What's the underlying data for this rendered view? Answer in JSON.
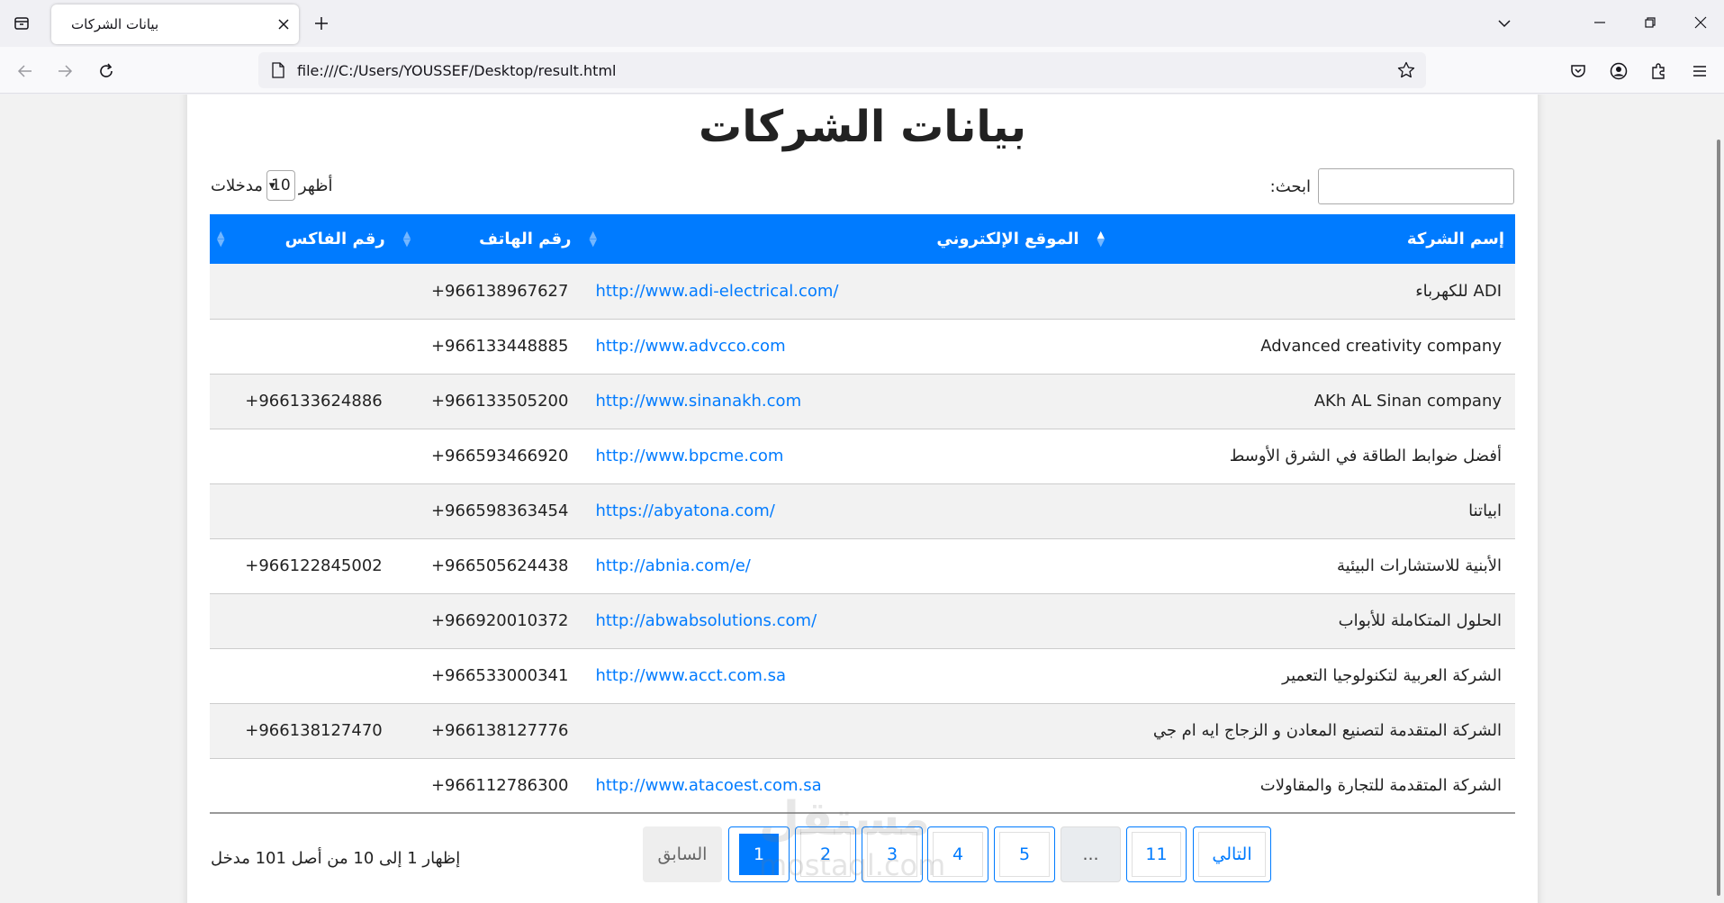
{
  "browser": {
    "tab_title": "بيانات الشركات",
    "url": "file:///C:/Users/YOUSSEF/Desktop/result.html"
  },
  "page": {
    "title": "بيانات الشركات",
    "length": {
      "show": "أظهر",
      "value": "10",
      "entries": "مدخلات"
    },
    "search_label": ":ابحث",
    "search_value": "",
    "columns": [
      "إسم الشركة",
      "الموقع الإلكتروني",
      "رقم الهاتف",
      "رقم الفاكس"
    ],
    "rows": [
      {
        "name": "ADI للكهرباء",
        "website": "http://www.adi-electrical.com/",
        "phone": "+966138967627",
        "fax": ""
      },
      {
        "name": "Advanced creativity company",
        "website": "http://www.advcco.com",
        "phone": "+966133448885",
        "fax": ""
      },
      {
        "name": "AKh AL Sinan company",
        "website": "http://www.sinanakh.com",
        "phone": "+966133505200",
        "fax": "+966133624886"
      },
      {
        "name": "أفضل ضوابط الطاقة في الشرق الأوسط",
        "website": "http://www.bpcme.com",
        "phone": "+966593466920",
        "fax": ""
      },
      {
        "name": "ابياتنا",
        "website": "https://abyatona.com/",
        "phone": "+966598363454",
        "fax": ""
      },
      {
        "name": "الأبنية للاستشارات البيئية",
        "website": "http://abnia.com/e/",
        "phone": "+966505624438",
        "fax": "+966122845002"
      },
      {
        "name": "الحلول المتكاملة للأبواب",
        "website": "http://abwabsolutions.com/",
        "phone": "+966920010372",
        "fax": ""
      },
      {
        "name": "الشركة العربية لتكنولوجيا التعمير",
        "website": "http://www.acct.com.sa",
        "phone": "+966533000341",
        "fax": ""
      },
      {
        "name": "الشركة المتقدمة لتصنيع المعادن و الزجاج ايه ام جي",
        "website": "",
        "phone": "+966138127776",
        "fax": "+966138127470"
      },
      {
        "name": "الشركة المتقدمة للتجارة والمقاولات",
        "website": "http://www.atacoest.com.sa",
        "phone": "+966112786300",
        "fax": ""
      }
    ],
    "info": "إظهار 1 إلى 10 من أصل 101 مدخل",
    "pagination": {
      "next": "التالي",
      "last": "11",
      "ellipsis": "...",
      "pages": [
        "5",
        "4",
        "3",
        "2",
        "1"
      ],
      "previous": "السابق"
    },
    "watermark": {
      "arabic": "مستقل",
      "latin": "mostaql.com"
    }
  },
  "colors": {
    "accent": "#007bff",
    "row_stripe": "#f2f2f2"
  }
}
